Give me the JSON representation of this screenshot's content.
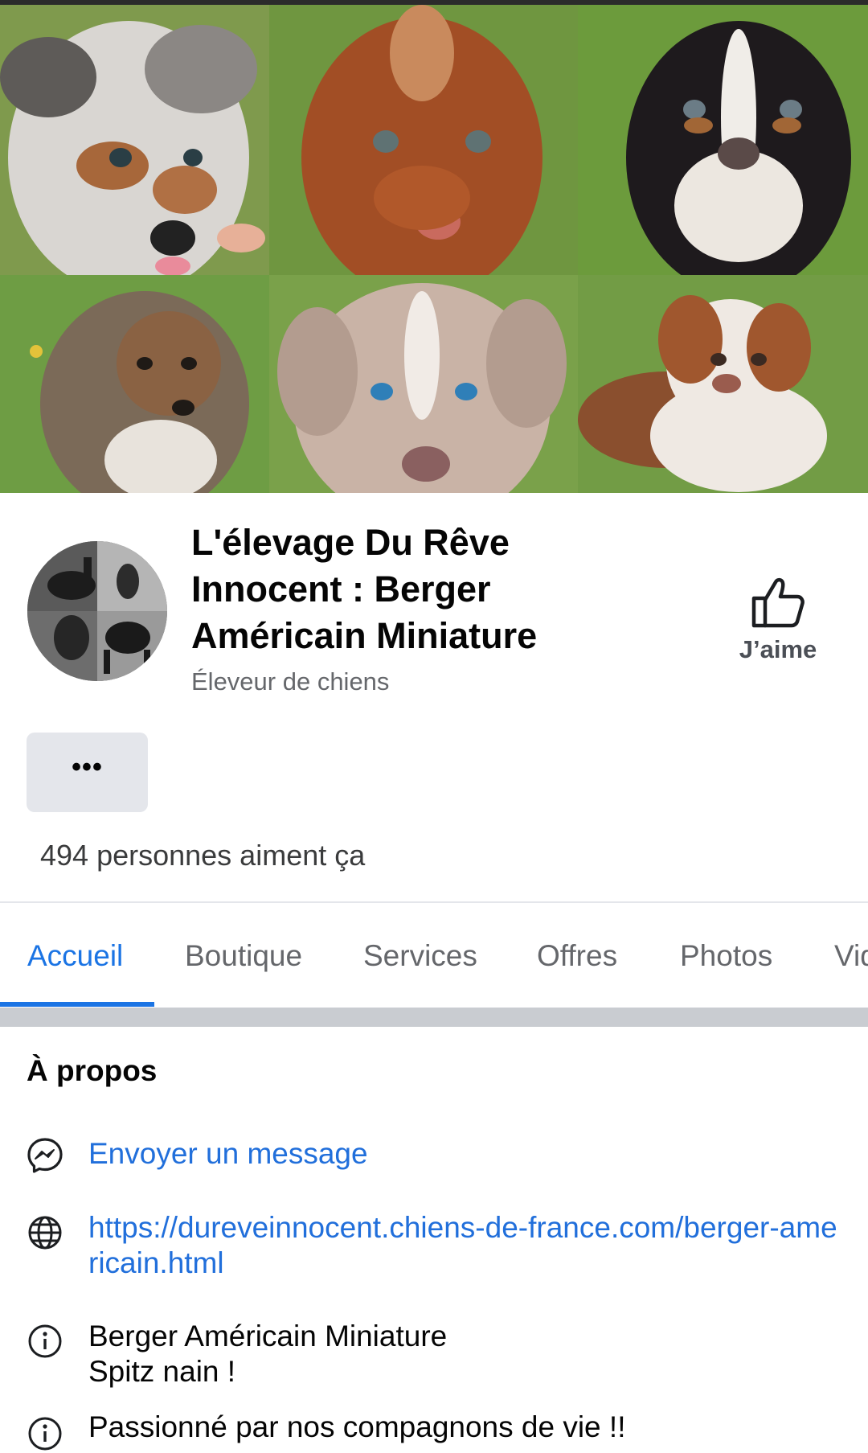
{
  "cover": {
    "tiles": [
      "puppy-merle",
      "puppy-red",
      "puppy-tricolor",
      "puppy-sable",
      "puppy-red-merle",
      "puppy-red-white"
    ]
  },
  "profile": {
    "name": "L'élevage Du Rêve Innocent : Berger Américain Miniature",
    "category": "Éleveur de chiens",
    "avatar_icon": "horse-collage"
  },
  "actions": {
    "like_label": "J’aime",
    "more_label": "•••"
  },
  "stats": {
    "likes_text": "494 personnes aiment ça"
  },
  "tabs": [
    {
      "label": "Accueil",
      "active": true
    },
    {
      "label": "Boutique",
      "active": false
    },
    {
      "label": "Services",
      "active": false
    },
    {
      "label": "Offres",
      "active": false
    },
    {
      "label": "Photos",
      "active": false
    },
    {
      "label": "Vidéos",
      "active": false
    }
  ],
  "about": {
    "title": "À propos",
    "message_label": "Envoyer un message",
    "website_url": "https://dureveinnocent.chiens-de-france.com/berger-americain.html",
    "info1": "Berger Américain Miniature\nSpitz nain !",
    "info2": "Passionné par nos compagnons de vie !!"
  },
  "colors": {
    "accent": "#1b74e4",
    "link": "#216fdb",
    "secondary_text": "#65676b",
    "button_bg": "#e4e6eb"
  }
}
